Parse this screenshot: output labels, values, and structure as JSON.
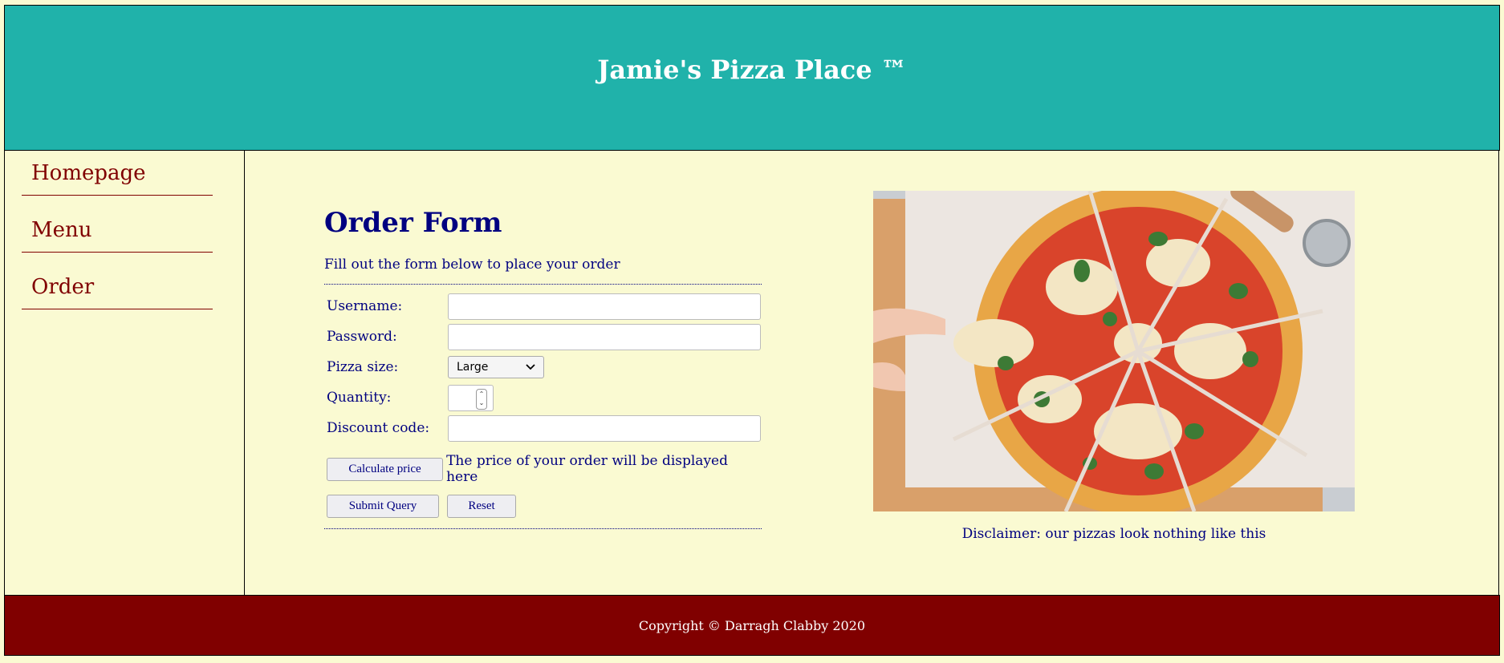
{
  "header": {
    "title": "Jamie's Pizza Place ™"
  },
  "sidebar": {
    "items": [
      {
        "label": "Homepage"
      },
      {
        "label": "Menu"
      },
      {
        "label": "Order"
      }
    ]
  },
  "form": {
    "title": "Order Form",
    "intro": "Fill out the form below to place your order",
    "username_label": "Username:",
    "username_value": "",
    "password_label": "Password:",
    "password_value": "",
    "size_label": "Pizza size:",
    "size_value": "Large",
    "quantity_label": "Quantity:",
    "quantity_value": "",
    "discount_label": "Discount code:",
    "discount_value": "",
    "calculate_label": "Calculate price",
    "price_text": "The price of your order will be displayed here",
    "submit_label": "Submit Query",
    "reset_label": "Reset"
  },
  "image": {
    "caption": "Disclaimer: our pizzas look nothing like this"
  },
  "footer": {
    "text": "Copyright © Darragh Clabby 2020"
  },
  "colors": {
    "header_bg": "#20b2aa",
    "page_bg": "#fafad2",
    "footer_bg": "#800000",
    "nav_text": "#800000",
    "form_text": "#000080"
  }
}
